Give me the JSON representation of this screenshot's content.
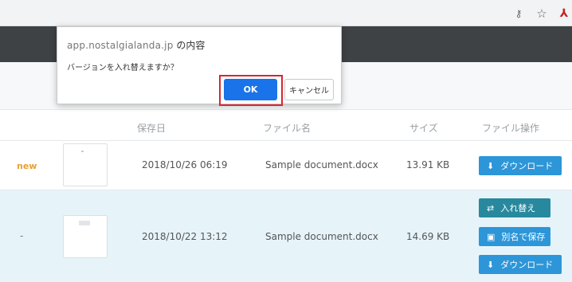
{
  "browser": {
    "icons": [
      "key-icon",
      "star-icon",
      "pdf-icon"
    ],
    "key_glyph": "⚷",
    "star_glyph": "☆",
    "pdf_glyph": "⅄"
  },
  "dialog": {
    "origin": "app.nostalgialanda.jp",
    "title_suffix": " の内容",
    "message": "バージョンを入れ替えますか？",
    "ok_label": "OK",
    "cancel_label": "キャンセル",
    "highlight_color": "#d7262e"
  },
  "table": {
    "headers": {
      "date": "保存日",
      "name": "ファイル名",
      "size": "サイズ",
      "ops": "ファイル操作"
    },
    "rows": [
      {
        "status": "new",
        "date": "2018/10/26 06:19",
        "name": "Sample document.docx",
        "size": "13.91 KB",
        "actions": [
          {
            "label": "ダウンロード",
            "icon": "download-icon",
            "glyph": "⬇"
          }
        ]
      },
      {
        "status": "-",
        "date": "2018/10/22 13:12",
        "name": "Sample document.docx",
        "size": "14.69 KB",
        "actions": [
          {
            "label": "入れ替え",
            "icon": "swap-icon",
            "glyph": "⇄"
          },
          {
            "label": "別名で保存",
            "icon": "save-icon",
            "glyph": "▣"
          },
          {
            "label": "ダウンロード",
            "icon": "download-icon",
            "glyph": "⬇"
          }
        ]
      }
    ]
  },
  "colors": {
    "header_dark": "#3e4245",
    "button_blue": "#2d96d8",
    "button_teal": "#28899e",
    "row_selected": "#e6f4fa",
    "status_new": "#e8a033",
    "ok_blue": "#1a73e8"
  }
}
